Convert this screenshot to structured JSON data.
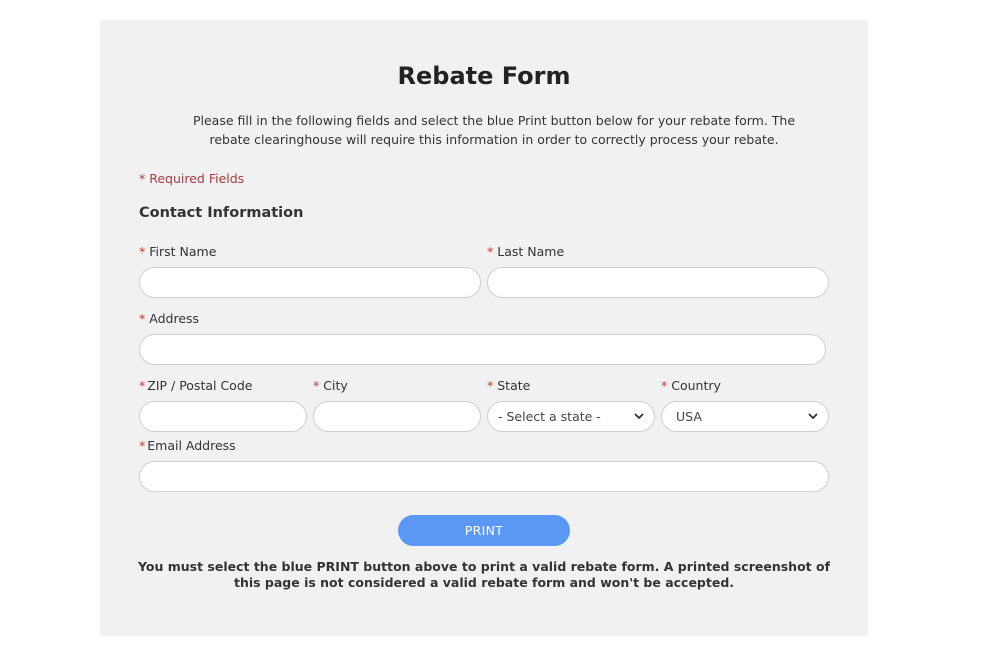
{
  "form": {
    "title": "Rebate Form",
    "intro": "Please fill in the following fields and select the blue Print button below for your rebate form. The rebate clearinghouse will require this information in order to correctly process your rebate.",
    "required_note": "* Required Fields",
    "section_title": "Contact Information",
    "required_marker": "*"
  },
  "fields": {
    "first_name": {
      "label": "First Name",
      "value": "",
      "placeholder": ""
    },
    "last_name": {
      "label": "Last Name",
      "value": "",
      "placeholder": ""
    },
    "address": {
      "label": "Address",
      "value": "",
      "placeholder": ""
    },
    "zip": {
      "label": "ZIP / Postal Code",
      "value": "",
      "placeholder": ""
    },
    "city": {
      "label": "City",
      "value": "",
      "placeholder": ""
    },
    "state": {
      "label": "State",
      "selected": "- Select a state -"
    },
    "country": {
      "label": "Country",
      "selected": "USA"
    },
    "email": {
      "label": "Email Address",
      "value": "",
      "placeholder": ""
    }
  },
  "actions": {
    "print_label": "PRINT"
  },
  "footer": {
    "note": "You must select the blue PRINT button above to print a valid rebate form. A printed screenshot of this page is not considered a valid rebate form and won't be accepted."
  },
  "colors": {
    "panel_bg": "#f1f1f1",
    "required_text": "#a83a42",
    "required_star": "#c0392b",
    "print_button": "#5b98f5"
  },
  "icons": {
    "select_arrow": "chevron-down-icon"
  }
}
